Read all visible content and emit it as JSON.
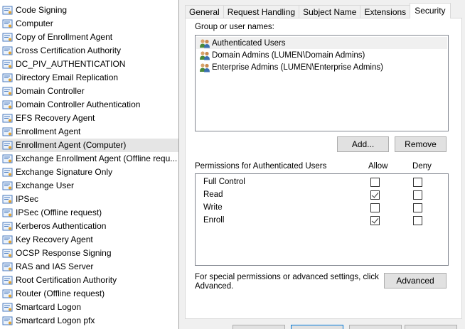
{
  "templates": [
    {
      "label": "Code Signing",
      "selected": false
    },
    {
      "label": "Computer",
      "selected": false
    },
    {
      "label": "Copy of Enrollment Agent",
      "selected": false
    },
    {
      "label": "Cross Certification Authority",
      "selected": false
    },
    {
      "label": "DC_PIV_AUTHENTICATION",
      "selected": false
    },
    {
      "label": "Directory Email Replication",
      "selected": false
    },
    {
      "label": "Domain Controller",
      "selected": false
    },
    {
      "label": "Domain Controller Authentication",
      "selected": false
    },
    {
      "label": "EFS Recovery Agent",
      "selected": false
    },
    {
      "label": "Enrollment Agent",
      "selected": false
    },
    {
      "label": "Enrollment Agent (Computer)",
      "selected": true
    },
    {
      "label": "Exchange Enrollment Agent (Offline requ...",
      "selected": false
    },
    {
      "label": "Exchange Signature Only",
      "selected": false
    },
    {
      "label": "Exchange User",
      "selected": false
    },
    {
      "label": "IPSec",
      "selected": false
    },
    {
      "label": "IPSec (Offline request)",
      "selected": false
    },
    {
      "label": "Kerberos Authentication",
      "selected": false
    },
    {
      "label": "Key Recovery Agent",
      "selected": false
    },
    {
      "label": "OCSP Response Signing",
      "selected": false
    },
    {
      "label": "RAS and IAS Server",
      "selected": false
    },
    {
      "label": "Root Certification Authority",
      "selected": false
    },
    {
      "label": "Router (Offline request)",
      "selected": false
    },
    {
      "label": "Smartcard Logon",
      "selected": false
    },
    {
      "label": "Smartcard Logon pfx",
      "selected": false
    }
  ],
  "tabs": [
    "General",
    "Request Handling",
    "Subject Name",
    "Extensions",
    "Security"
  ],
  "active_tab": "Security",
  "security": {
    "group_label": "Group or user names:",
    "users": [
      {
        "name": "Authenticated Users",
        "selected": true
      },
      {
        "name": "Domain Admins (LUMEN\\Domain Admins)",
        "selected": false
      },
      {
        "name": "Enterprise Admins (LUMEN\\Enterprise Admins)",
        "selected": false
      }
    ],
    "add_button": "Add...",
    "remove_button": "Remove",
    "permissions_label": "Permissions for Authenticated Users",
    "allow_header": "Allow",
    "deny_header": "Deny",
    "permissions": [
      {
        "name": "Full Control",
        "allow": false,
        "deny": false
      },
      {
        "name": "Read",
        "allow": true,
        "deny": false
      },
      {
        "name": "Write",
        "allow": false,
        "deny": false
      },
      {
        "name": "Enroll",
        "allow": true,
        "deny": false
      }
    ],
    "special_text_line1": "For special permissions or advanced settings, click",
    "special_text_line2": "Advanced.",
    "advanced_button": "Advanced"
  },
  "colors": {
    "selected_row": "#e5e5e5",
    "dialog_bg": "#f0f0f0",
    "button_bg": "#e1e1e1",
    "default_button_border": "#0078d7"
  },
  "icons": {
    "template": "certificate-template-icon",
    "user_group": "user-group-icon"
  }
}
